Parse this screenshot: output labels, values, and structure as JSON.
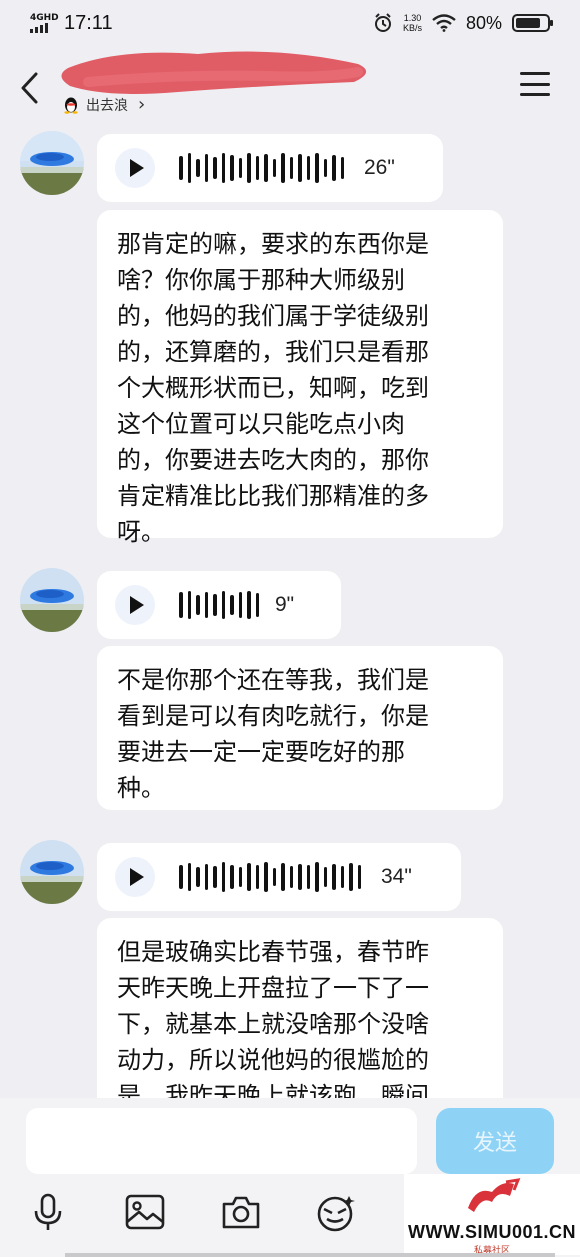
{
  "status_bar": {
    "network": "4GHD",
    "time": "17:11",
    "speed_value": "1.30",
    "speed_unit": "KB/s",
    "battery": "80%",
    "battery_level": 0.8
  },
  "header": {
    "back_icon": "chevron-left-icon",
    "subtitle": "出去浪",
    "subtitle_arrow": "›",
    "menu_icon": "hamburger-menu-icon"
  },
  "messages": [
    {
      "type": "voice",
      "duration": "26\""
    },
    {
      "type": "text",
      "lines": [
        "那肯定的嘛，要求的东西你是",
        "啥？你你属于那种大师级别",
        "的，他妈的我们属于学徒级别",
        "的，还算磨的，我们只是看那",
        "个大概形状而已，知啊，吃到",
        "这个位置可以只能吃点小肉",
        "的，你要进去吃大肉的，那你",
        "肯定精准比比我们那精准的多",
        "呀。"
      ]
    },
    {
      "type": "voice",
      "duration": "9\""
    },
    {
      "type": "text",
      "lines": [
        "不是你那个还在等我，我们是",
        "看到是可以有肉吃就行，你是",
        "要进去一定一定要吃好的那",
        "种。"
      ]
    },
    {
      "type": "voice",
      "duration": "34\""
    },
    {
      "type": "text",
      "lines": [
        "但是玻确实比春节强，春节昨",
        "天昨天晚上开盘拉了一下了一",
        "下，就基本上就没啥那个没啥",
        "动力，所以说他妈的很尴尬的",
        "是，我昨天晚上就该跑，瞬间"
      ]
    }
  ],
  "input": {
    "placeholder": "",
    "send_label": "发送"
  },
  "toolbar": {
    "icons": [
      "microphone-icon",
      "image-icon",
      "camera-icon",
      "emoji-icon"
    ]
  },
  "watermark": {
    "text": "WWW.SIMU001.CN",
    "sub": "私募社区"
  },
  "colors": {
    "background": "#efeff3",
    "bubble": "#ffffff",
    "send_button": "#8ed3f5",
    "redaction": "#e0505a"
  }
}
